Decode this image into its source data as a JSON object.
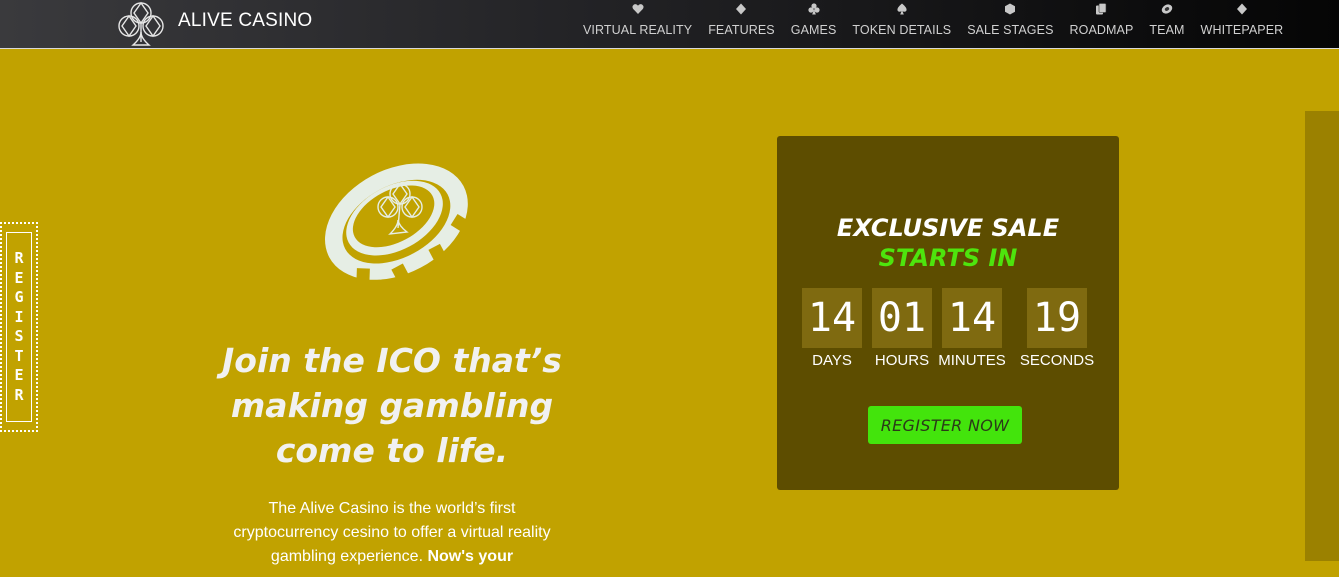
{
  "header": {
    "brand_name": "ALIVE CASINO",
    "logo_icon": "club-clover-logo-icon",
    "nav": [
      {
        "label": "VIRTUAL REALITY",
        "icon": "heart-icon"
      },
      {
        "label": "FEATURES",
        "icon": "diamond-icon"
      },
      {
        "label": "GAMES",
        "icon": "club-icon"
      },
      {
        "label": "TOKEN DETAILS",
        "icon": "spade-icon"
      },
      {
        "label": "SALE STAGES",
        "icon": "chip-icon"
      },
      {
        "label": "ROADMAP",
        "icon": "cards-icon"
      },
      {
        "label": "TEAM",
        "icon": "casino-chip-icon"
      },
      {
        "label": "WHITEPAPER",
        "icon": "diamond-icon"
      }
    ]
  },
  "side_tab": {
    "label": "REGISTER"
  },
  "hero": {
    "title": "Join the ICO that’s making gambling come to life.",
    "description": "The Alive Casino is the world’s first cryptocurrency cesino to offer a virtual reality gambling experience.",
    "description_bold": "Now's your"
  },
  "sale": {
    "title": "EXCLUSIVE SALE",
    "subtitle": "STARTS IN",
    "countdown": [
      {
        "value": "14",
        "label": "DAYS"
      },
      {
        "value": "01",
        "label": "HOURS"
      },
      {
        "value": "14",
        "label": "MINUTES"
      },
      {
        "value": "19",
        "label": "SECONDS"
      }
    ],
    "cta_label": "REGISTER NOW"
  },
  "colors": {
    "background": "#c1a200",
    "sale_box": "#5d4d00",
    "accent_green": "#43e40c",
    "subtitle_green": "#4ee40d",
    "chip": "#e7efe6"
  }
}
